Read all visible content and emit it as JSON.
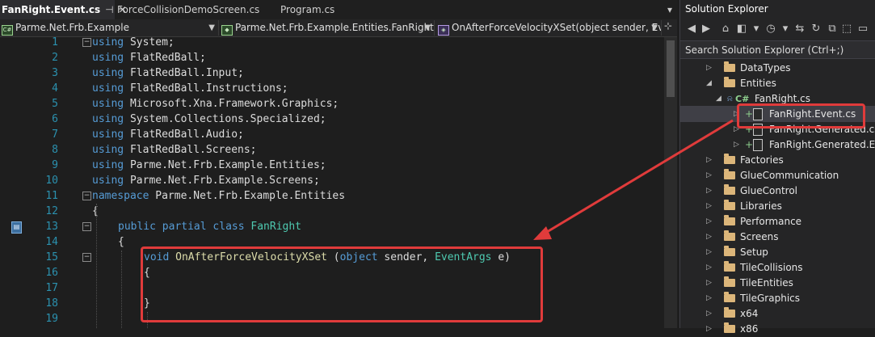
{
  "tabs": [
    {
      "label": "FanRight.Event.cs",
      "pin": "⊣",
      "close": "✕",
      "active": true
    },
    {
      "label": "ForceCollisionDemoScreen.cs",
      "active": false
    },
    {
      "label": "Program.cs",
      "active": false
    }
  ],
  "tabbar_dropdown": "▾",
  "navbar": {
    "project": "Parme.Net.Frb.Example",
    "class": "Parme.Net.Frb.Example.Entities.FanRight",
    "member": "OnAfterForceVelocityXSet(object sender, Event",
    "split_icon": "⊹"
  },
  "editor": {
    "lines": [
      {
        "num": "1",
        "tokens": [
          [
            "kw",
            "using"
          ],
          [
            "id",
            " System;"
          ]
        ]
      },
      {
        "num": "2",
        "tokens": [
          [
            "kw",
            "using"
          ],
          [
            "id",
            " FlatRedBall;"
          ]
        ]
      },
      {
        "num": "3",
        "tokens": [
          [
            "kw",
            "using"
          ],
          [
            "id",
            " FlatRedBall.Input;"
          ]
        ]
      },
      {
        "num": "4",
        "tokens": [
          [
            "kw",
            "using"
          ],
          [
            "id",
            " FlatRedBall.Instructions;"
          ]
        ]
      },
      {
        "num": "5",
        "tokens": [
          [
            "kw",
            "using"
          ],
          [
            "id",
            " Microsoft.Xna.Framework.Graphics;"
          ]
        ]
      },
      {
        "num": "6",
        "tokens": [
          [
            "kw",
            "using"
          ],
          [
            "id",
            " System.Collections.Specialized;"
          ]
        ]
      },
      {
        "num": "7",
        "tokens": [
          [
            "kw",
            "using"
          ],
          [
            "id",
            " FlatRedBall.Audio;"
          ]
        ]
      },
      {
        "num": "8",
        "tokens": [
          [
            "kw",
            "using"
          ],
          [
            "id",
            " FlatRedBall.Screens;"
          ]
        ]
      },
      {
        "num": "9",
        "tokens": [
          [
            "kw",
            "using"
          ],
          [
            "id",
            " Parme.Net.Frb.Example.Entities;"
          ]
        ]
      },
      {
        "num": "10",
        "tokens": [
          [
            "kw",
            "using"
          ],
          [
            "id",
            " Parme.Net.Frb.Example.Screens;"
          ]
        ]
      },
      {
        "num": "11",
        "tokens": [
          [
            "kw",
            "namespace"
          ],
          [
            "id",
            " Parme.Net.Frb.Example.Entities"
          ]
        ]
      },
      {
        "num": "12",
        "tokens": [
          [
            "id",
            "{"
          ]
        ]
      },
      {
        "num": "13",
        "tokens": [
          [
            "kw",
            "public"
          ],
          [
            "id",
            " "
          ],
          [
            "kw",
            "partial"
          ],
          [
            "id",
            " "
          ],
          [
            "kw",
            "class"
          ],
          [
            "id",
            " "
          ],
          [
            "ty",
            "FanRight"
          ]
        ]
      },
      {
        "num": "14",
        "tokens": [
          [
            "id",
            "{"
          ]
        ]
      },
      {
        "num": "15",
        "tokens": [
          [
            "kw",
            "void"
          ],
          [
            "id",
            " "
          ],
          [
            "fn",
            "OnAfterForceVelocityXSet"
          ],
          [
            "id",
            " ("
          ],
          [
            "kw",
            "object"
          ],
          [
            "id",
            " sender, "
          ],
          [
            "ty",
            "EventArgs"
          ],
          [
            "id",
            " e)"
          ]
        ]
      },
      {
        "num": "16",
        "tokens": [
          [
            "id",
            "{"
          ]
        ]
      },
      {
        "num": "17",
        "tokens": []
      },
      {
        "num": "18",
        "tokens": [
          [
            "id",
            "}"
          ]
        ]
      },
      {
        "num": "19",
        "tokens": []
      }
    ],
    "bookmark_icon": "▤"
  },
  "solution_explorer": {
    "title": "Solution Explorer",
    "search_placeholder": "Search Solution Explorer (Ctrl+;)",
    "toolbar_icons": [
      "back-icon",
      "forward-icon",
      "home-icon",
      "vs-icon",
      "dropdown-icon",
      "history-icon",
      "dropdown-icon",
      "sync-icon",
      "refresh-icon",
      "collapse-all-icon",
      "copy-icon",
      "properties-icon"
    ],
    "toolbar_glyphs": [
      "◀",
      "▶",
      "⌂",
      "◧",
      "▾",
      "◷",
      "▾",
      "⇆",
      "↻",
      "⧉",
      "⬚",
      "▭"
    ],
    "items": [
      {
        "label": "DataTypes",
        "kind": "folder",
        "expanded": false
      },
      {
        "label": "Entities",
        "kind": "folder",
        "expanded": true
      },
      {
        "label": "FanRight.cs",
        "kind": "cs",
        "expanded": true
      },
      {
        "label": "FanRight.Event.cs",
        "kind": "file",
        "selected": true
      },
      {
        "label": "FanRight.Generated.cs",
        "kind": "file"
      },
      {
        "label": "FanRight.Generated.Event.cs",
        "kind": "file"
      },
      {
        "label": "Factories",
        "kind": "folder"
      },
      {
        "label": "GlueCommunication",
        "kind": "folder"
      },
      {
        "label": "GlueControl",
        "kind": "folder"
      },
      {
        "label": "Libraries",
        "kind": "folder"
      },
      {
        "label": "Performance",
        "kind": "folder"
      },
      {
        "label": "Screens",
        "kind": "folder"
      },
      {
        "label": "Setup",
        "kind": "folder"
      },
      {
        "label": "TileCollisions",
        "kind": "folder"
      },
      {
        "label": "TileEntities",
        "kind": "folder"
      },
      {
        "label": "TileGraphics",
        "kind": "folder"
      },
      {
        "label": "x64",
        "kind": "folder"
      },
      {
        "label": "x86",
        "kind": "folder"
      }
    ]
  },
  "annotation_color": "#e03b3b"
}
